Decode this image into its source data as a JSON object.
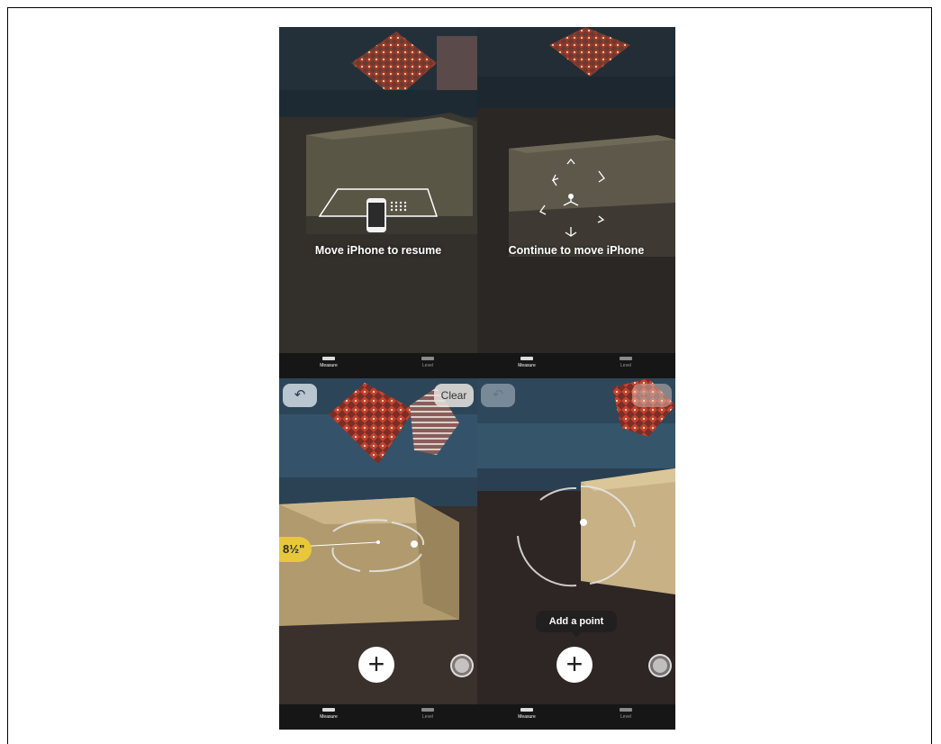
{
  "tabs": {
    "measure": "Measure",
    "level": "Level"
  },
  "panel1": {
    "message": "Move iPhone to resume"
  },
  "panel2": {
    "message": "Continue to move iPhone"
  },
  "panel3": {
    "clear": "Clear",
    "undo_icon": "undo-arrow-icon",
    "measurement": "8½\"",
    "add_icon": "plus-icon"
  },
  "panel4": {
    "clear": "Clear",
    "undo_icon": "undo-arrow-icon",
    "tooltip": "Add a point",
    "add_icon": "plus-icon"
  },
  "colors": {
    "measure_badge": "#e8c83a",
    "tab_bar": "#161616",
    "couch": "#2c4558"
  }
}
